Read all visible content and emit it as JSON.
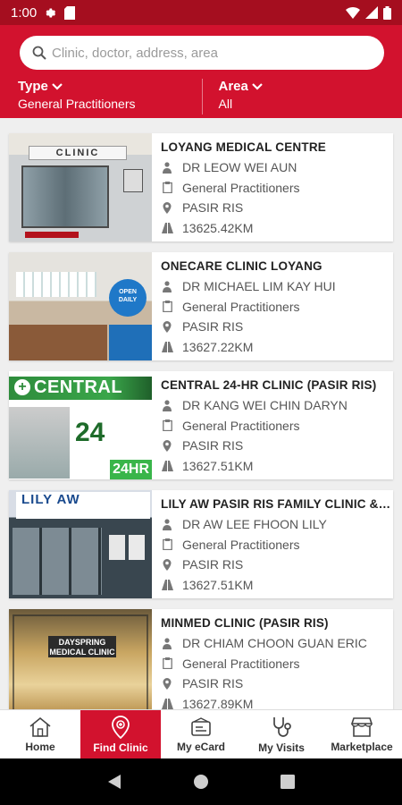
{
  "status_bar": {
    "time": "1:00"
  },
  "search": {
    "placeholder": "Clinic, doctor, address, area"
  },
  "filters": {
    "type": {
      "label": "Type",
      "value": "General Practitioners"
    },
    "area": {
      "label": "Area",
      "value": "All"
    }
  },
  "clinics": [
    {
      "name": "LOYANG MEDICAL CENTRE",
      "doctor": "DR LEOW WEI AUN",
      "specialty": "General Practitioners",
      "area": "PASIR RIS",
      "distance": "13625.42KM",
      "image_text": "CLINIC"
    },
    {
      "name": "ONECARE CLINIC LOYANG",
      "doctor": "DR MICHAEL LIM KAY HUI",
      "specialty": "General Practitioners",
      "area": "PASIR RIS",
      "distance": "13627.22KM",
      "image_text": "OPEN DAILY"
    },
    {
      "name": "CENTRAL 24-HR CLINIC (PASIR RIS)",
      "doctor": "DR KANG WEI CHIN DARYN",
      "specialty": "General Practitioners",
      "area": "PASIR RIS",
      "distance": "13627.51KM",
      "image_text": "CENTRAL",
      "image_big": "24",
      "badge": "24HR"
    },
    {
      "name": "LILY AW PASIR RIS FAMILY CLINIC & SURGERY",
      "doctor": "DR AW LEE FHOON LILY",
      "specialty": "General Practitioners",
      "area": "PASIR RIS",
      "distance": "13627.51KM",
      "image_text": "LILY AW"
    },
    {
      "name": "MINMED CLINIC (PASIR RIS)",
      "doctor": "DR CHIAM CHOON GUAN ERIC",
      "specialty": "General Practitioners",
      "area": "PASIR RIS",
      "distance": "13627.89KM",
      "image_text": "DAYSPRING MEDICAL CLINIC"
    }
  ],
  "tabbar": {
    "items": [
      {
        "label": "Home",
        "icon": "home-icon"
      },
      {
        "label": "Find Clinic",
        "icon": "location-pin-icon",
        "active": true
      },
      {
        "label": "My eCard",
        "icon": "card-icon"
      },
      {
        "label": "My Visits",
        "icon": "stethoscope-icon"
      },
      {
        "label": "Marketplace",
        "icon": "store-icon"
      }
    ]
  },
  "colors": {
    "brand_red": "#d2122e",
    "status_red": "#a50e1f",
    "active_tab": "#d2122e"
  }
}
